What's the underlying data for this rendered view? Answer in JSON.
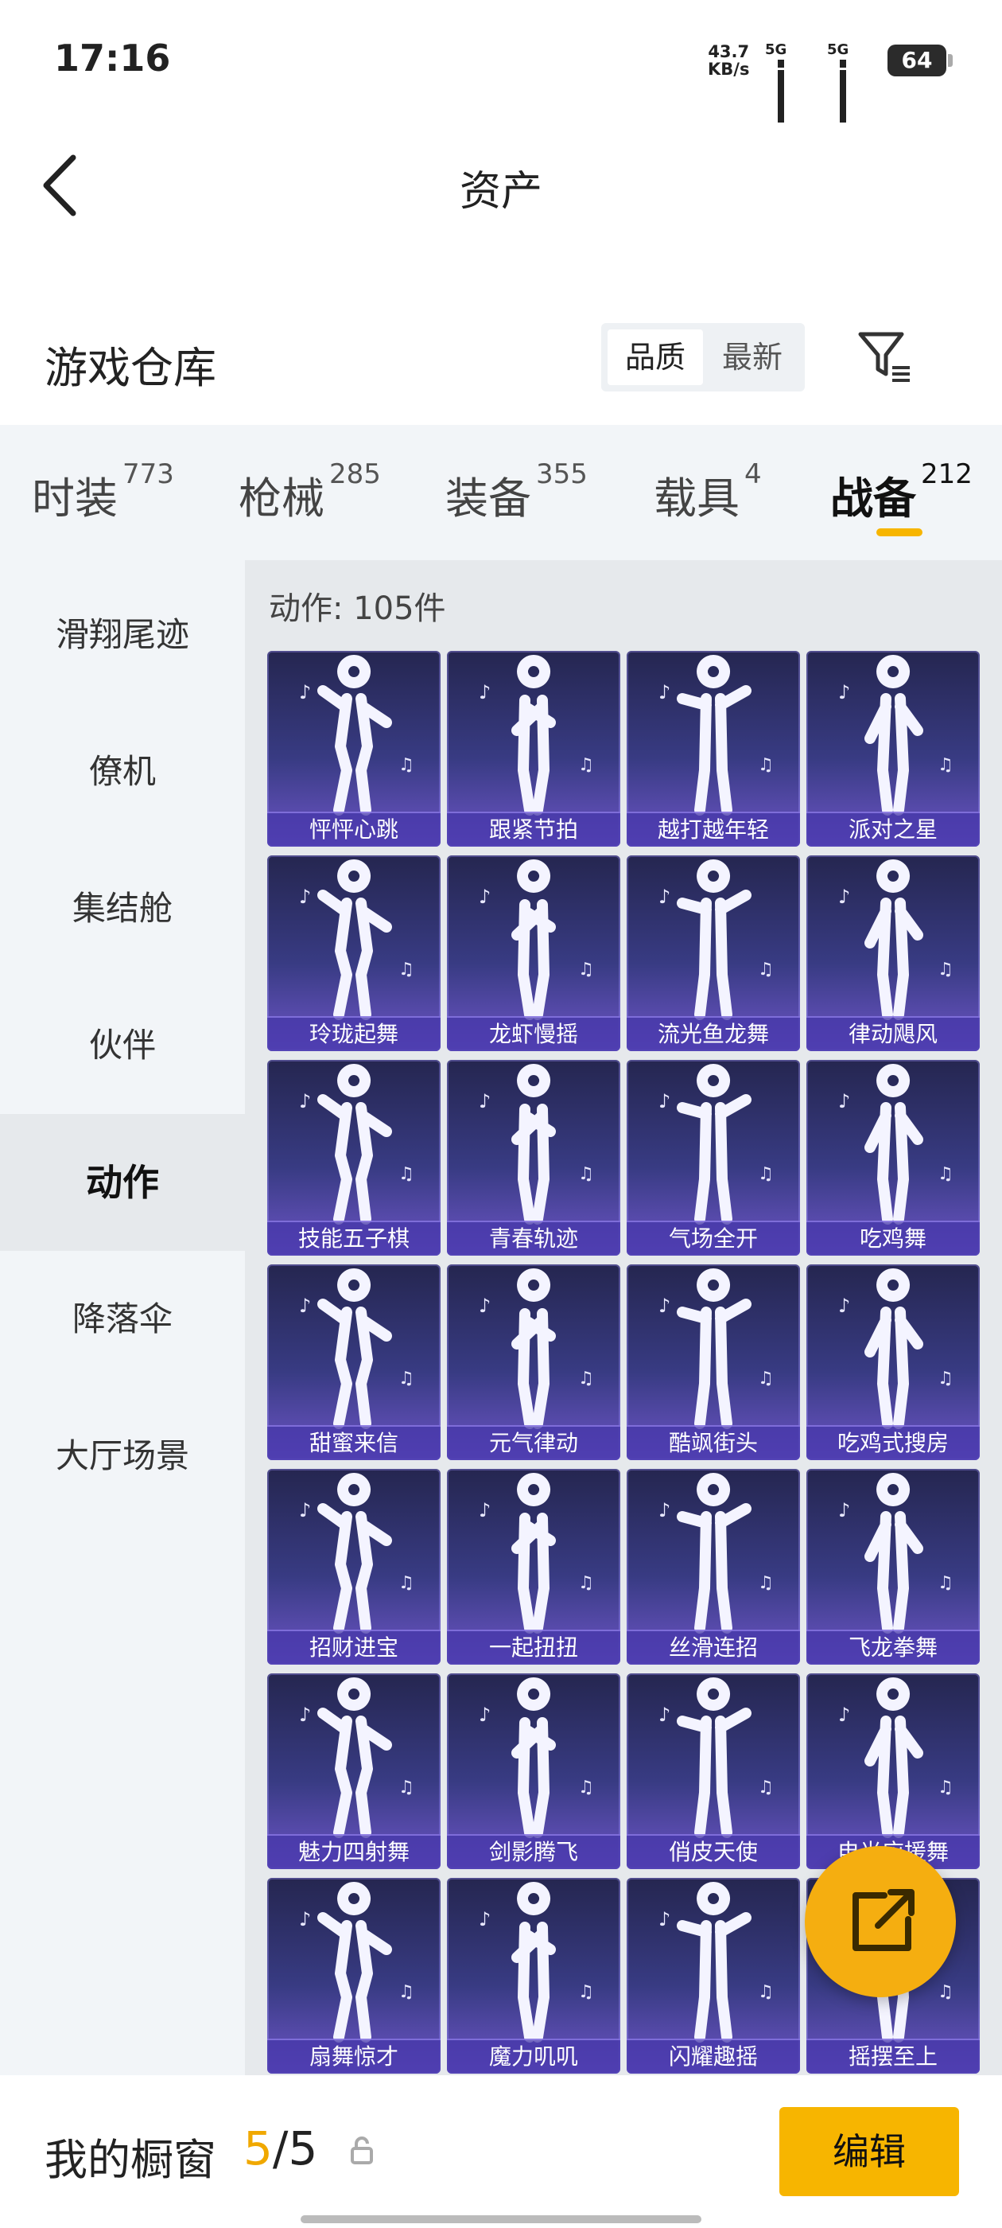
{
  "status_bar": {
    "time": "17:16",
    "rate_value": "43.7",
    "rate_unit": "KB/s",
    "net1": "5G",
    "net2": "5G",
    "battery": "64"
  },
  "header": {
    "title": "资产"
  },
  "warehouse": {
    "title": "游戏仓库",
    "sort_quality": "品质",
    "sort_latest": "最新"
  },
  "tabs": [
    {
      "label": "时装",
      "count": "773"
    },
    {
      "label": "枪械",
      "count": "285"
    },
    {
      "label": "装备",
      "count": "355"
    },
    {
      "label": "载具",
      "count": "4"
    },
    {
      "label": "战备",
      "count": "212"
    }
  ],
  "sidebar": {
    "items": [
      "滑翔尾迹",
      "僚机",
      "集结舱",
      "伙伴",
      "动作",
      "降落伞",
      "大厅场景"
    ],
    "active": "动作"
  },
  "content": {
    "count_text": "动作: 105件",
    "items": [
      "怦怦心跳",
      "跟紧节拍",
      "越打越年轻",
      "派对之星",
      "玲珑起舞",
      "龙虾慢摇",
      "流光鱼龙舞",
      "律动飓风",
      "技能五子棋",
      "青春轨迹",
      "气场全开",
      "吃鸡舞",
      "甜蜜来信",
      "元气律动",
      "酷飒街头",
      "吃鸡式搜房",
      "招财进宝",
      "一起扭扭",
      "丝滑连招",
      "飞龙拳舞",
      "魅力四射舞",
      "剑影腾飞",
      "俏皮天使",
      "电光应援舞",
      "扇舞惊才",
      "魔力叽叽",
      "闪耀趣摇",
      "摇摆至上"
    ]
  },
  "showcase": {
    "label": "我的橱窗",
    "current": "5",
    "sep": "/",
    "max": "5",
    "edit_label": "编辑"
  },
  "colors": {
    "accent": "#f7b500",
    "card_top": "#252650",
    "card_bottom": "#6d55c7"
  }
}
